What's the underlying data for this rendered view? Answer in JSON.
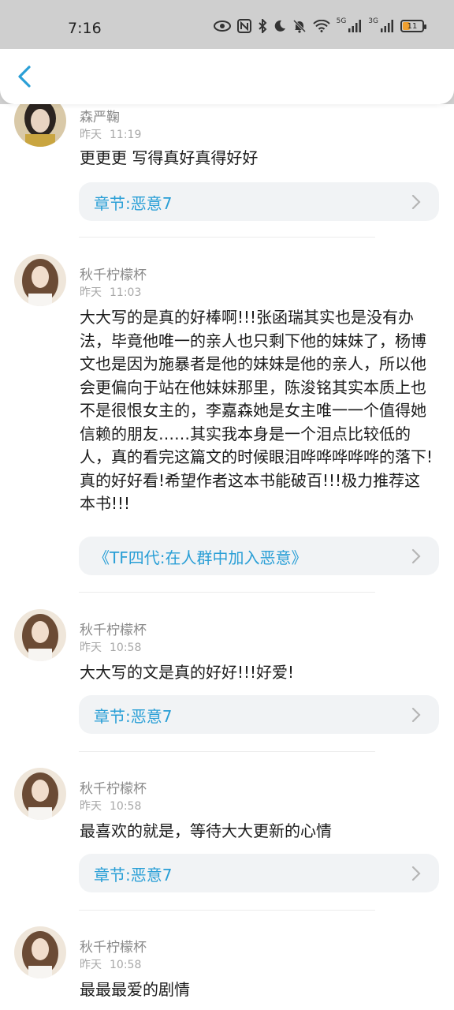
{
  "status_bar": {
    "time": "7:16",
    "battery": "11",
    "net1": "5G",
    "net2": "3G"
  },
  "colors": {
    "accent": "#2a9fd6",
    "bar_bg": "#cfcfcf",
    "chip_bg": "#f1f3f5"
  },
  "comments": [
    {
      "name": "森严鞠",
      "day": "昨天",
      "clock": "11:19",
      "text": "更更更 写得真好真得好好",
      "link": "章节:恶意7"
    },
    {
      "name": "秋千柠檬杯",
      "day": "昨天",
      "clock": "11:03",
      "text": "大大写的是真的好棒啊!!!张函瑞其实也是没有办法，毕竟他唯一的亲人也只剩下他的妹妹了，杨博文也是因为施暴者是他的妹妹是他的亲人，所以他会更偏向于站在他妹妹那里，陈浚铭其实本质上也不是很恨女主的，李嘉森她是女主唯一一个值得她信赖的朋友……其实我本身是一个泪点比较低的人，真的看完这篇文的时候眼泪哗哗哗哗哗的落下!真的好好看!希望作者这本书能破百!!!极力推荐这本书!!!",
      "link": "《TF四代:在人群中加入恶意》"
    },
    {
      "name": "秋千柠檬杯",
      "day": "昨天",
      "clock": "10:58",
      "text": "大大写的文是真的好好!!!好爱!",
      "link": "章节:恶意7"
    },
    {
      "name": "秋千柠檬杯",
      "day": "昨天",
      "clock": "10:58",
      "text": "最喜欢的就是，等待大大更新的心情",
      "link": "章节:恶意7"
    },
    {
      "name": "秋千柠檬杯",
      "day": "昨天",
      "clock": "10:58",
      "text": "最最最爱的剧情",
      "link": ""
    }
  ]
}
